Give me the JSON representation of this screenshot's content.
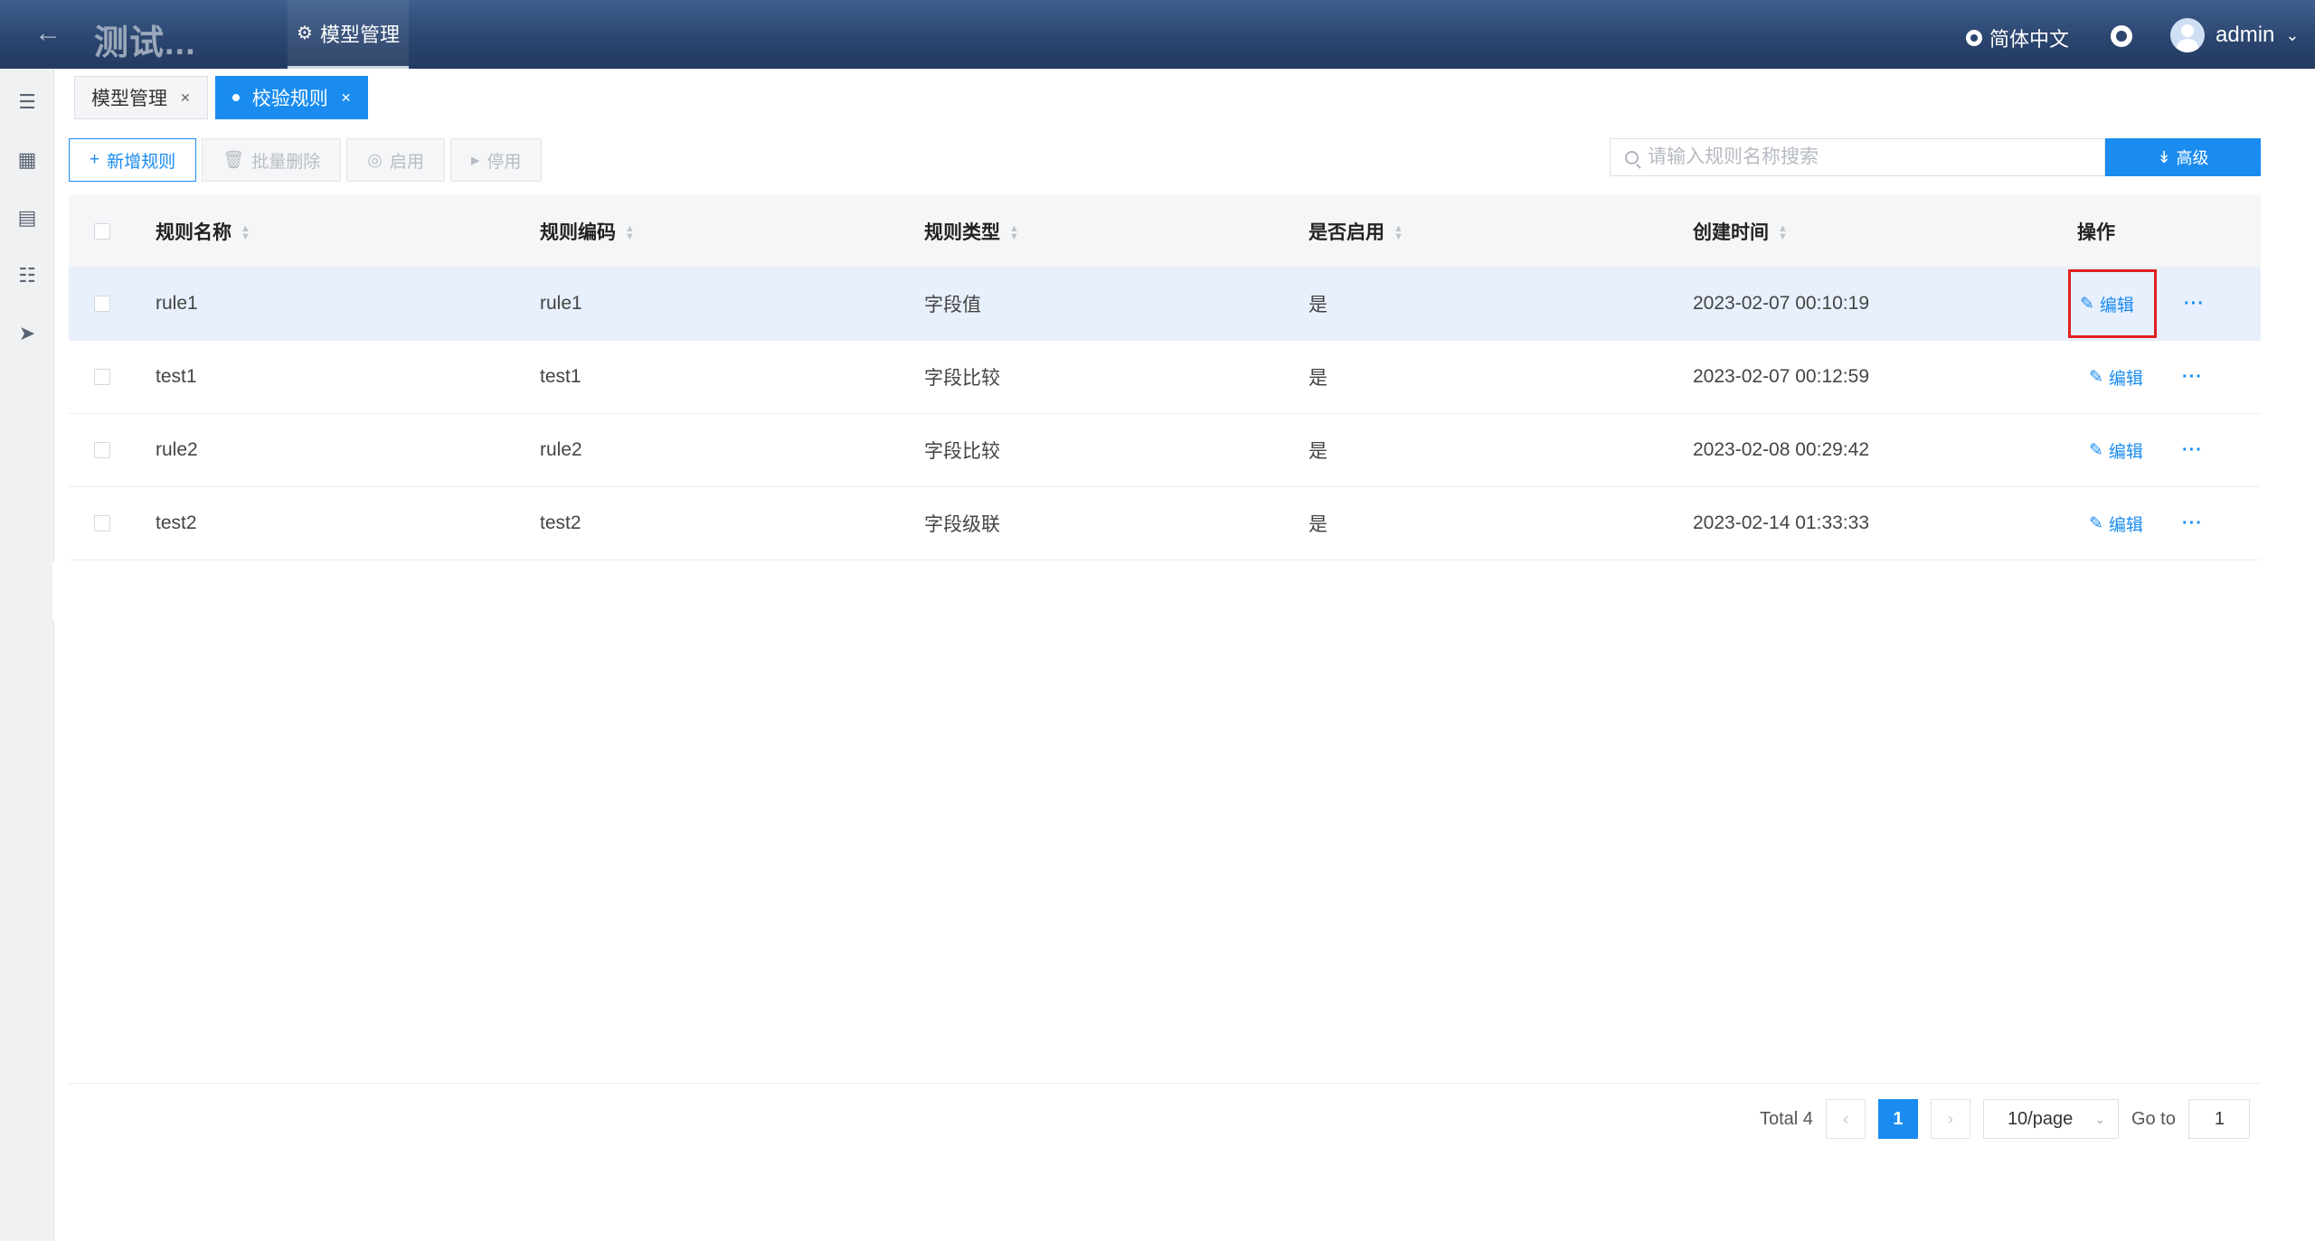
{
  "header": {
    "back_icon": "arrow-left-icon",
    "app_title": "测试...",
    "nav_item": "模型管理",
    "language": "简体中文",
    "user_name": "admin"
  },
  "tabs": [
    {
      "label": "模型管理",
      "active": false
    },
    {
      "label": "校验规则",
      "active": true
    }
  ],
  "toolbar": {
    "add_rule": "新增规则",
    "batch_delete": "批量删除",
    "enable": "启用",
    "disable": "停用"
  },
  "search": {
    "placeholder": "请输入规则名称搜索",
    "advanced_label": "高级"
  },
  "table": {
    "columns": [
      "规则名称",
      "规则编码",
      "规则类型",
      "是否启用",
      "创建时间",
      "操作"
    ],
    "rows": [
      {
        "name": "rule1",
        "code": "rule1",
        "type": "字段值",
        "enabled": "是",
        "created": "2023-02-07 00:10:19"
      },
      {
        "name": "test1",
        "code": "test1",
        "type": "字段比较",
        "enabled": "是",
        "created": "2023-02-07 00:12:59"
      },
      {
        "name": "rule2",
        "code": "rule2",
        "type": "字段比较",
        "enabled": "是",
        "created": "2023-02-08 00:29:42"
      },
      {
        "name": "test2",
        "code": "test2",
        "type": "字段级联",
        "enabled": "是",
        "created": "2023-02-14 01:33:33"
      }
    ],
    "edit_label": "编辑",
    "more_label": "···"
  },
  "pagination": {
    "total": "Total 4",
    "current_page": "1",
    "page_size": "10/page",
    "goto_label": "Go to",
    "goto_value": "1"
  },
  "colors": {
    "header_bg": "#2c4670",
    "primary": "#1a8cf0",
    "highlight_row": "#e8f0fd",
    "annotation_box": "#e02020"
  }
}
